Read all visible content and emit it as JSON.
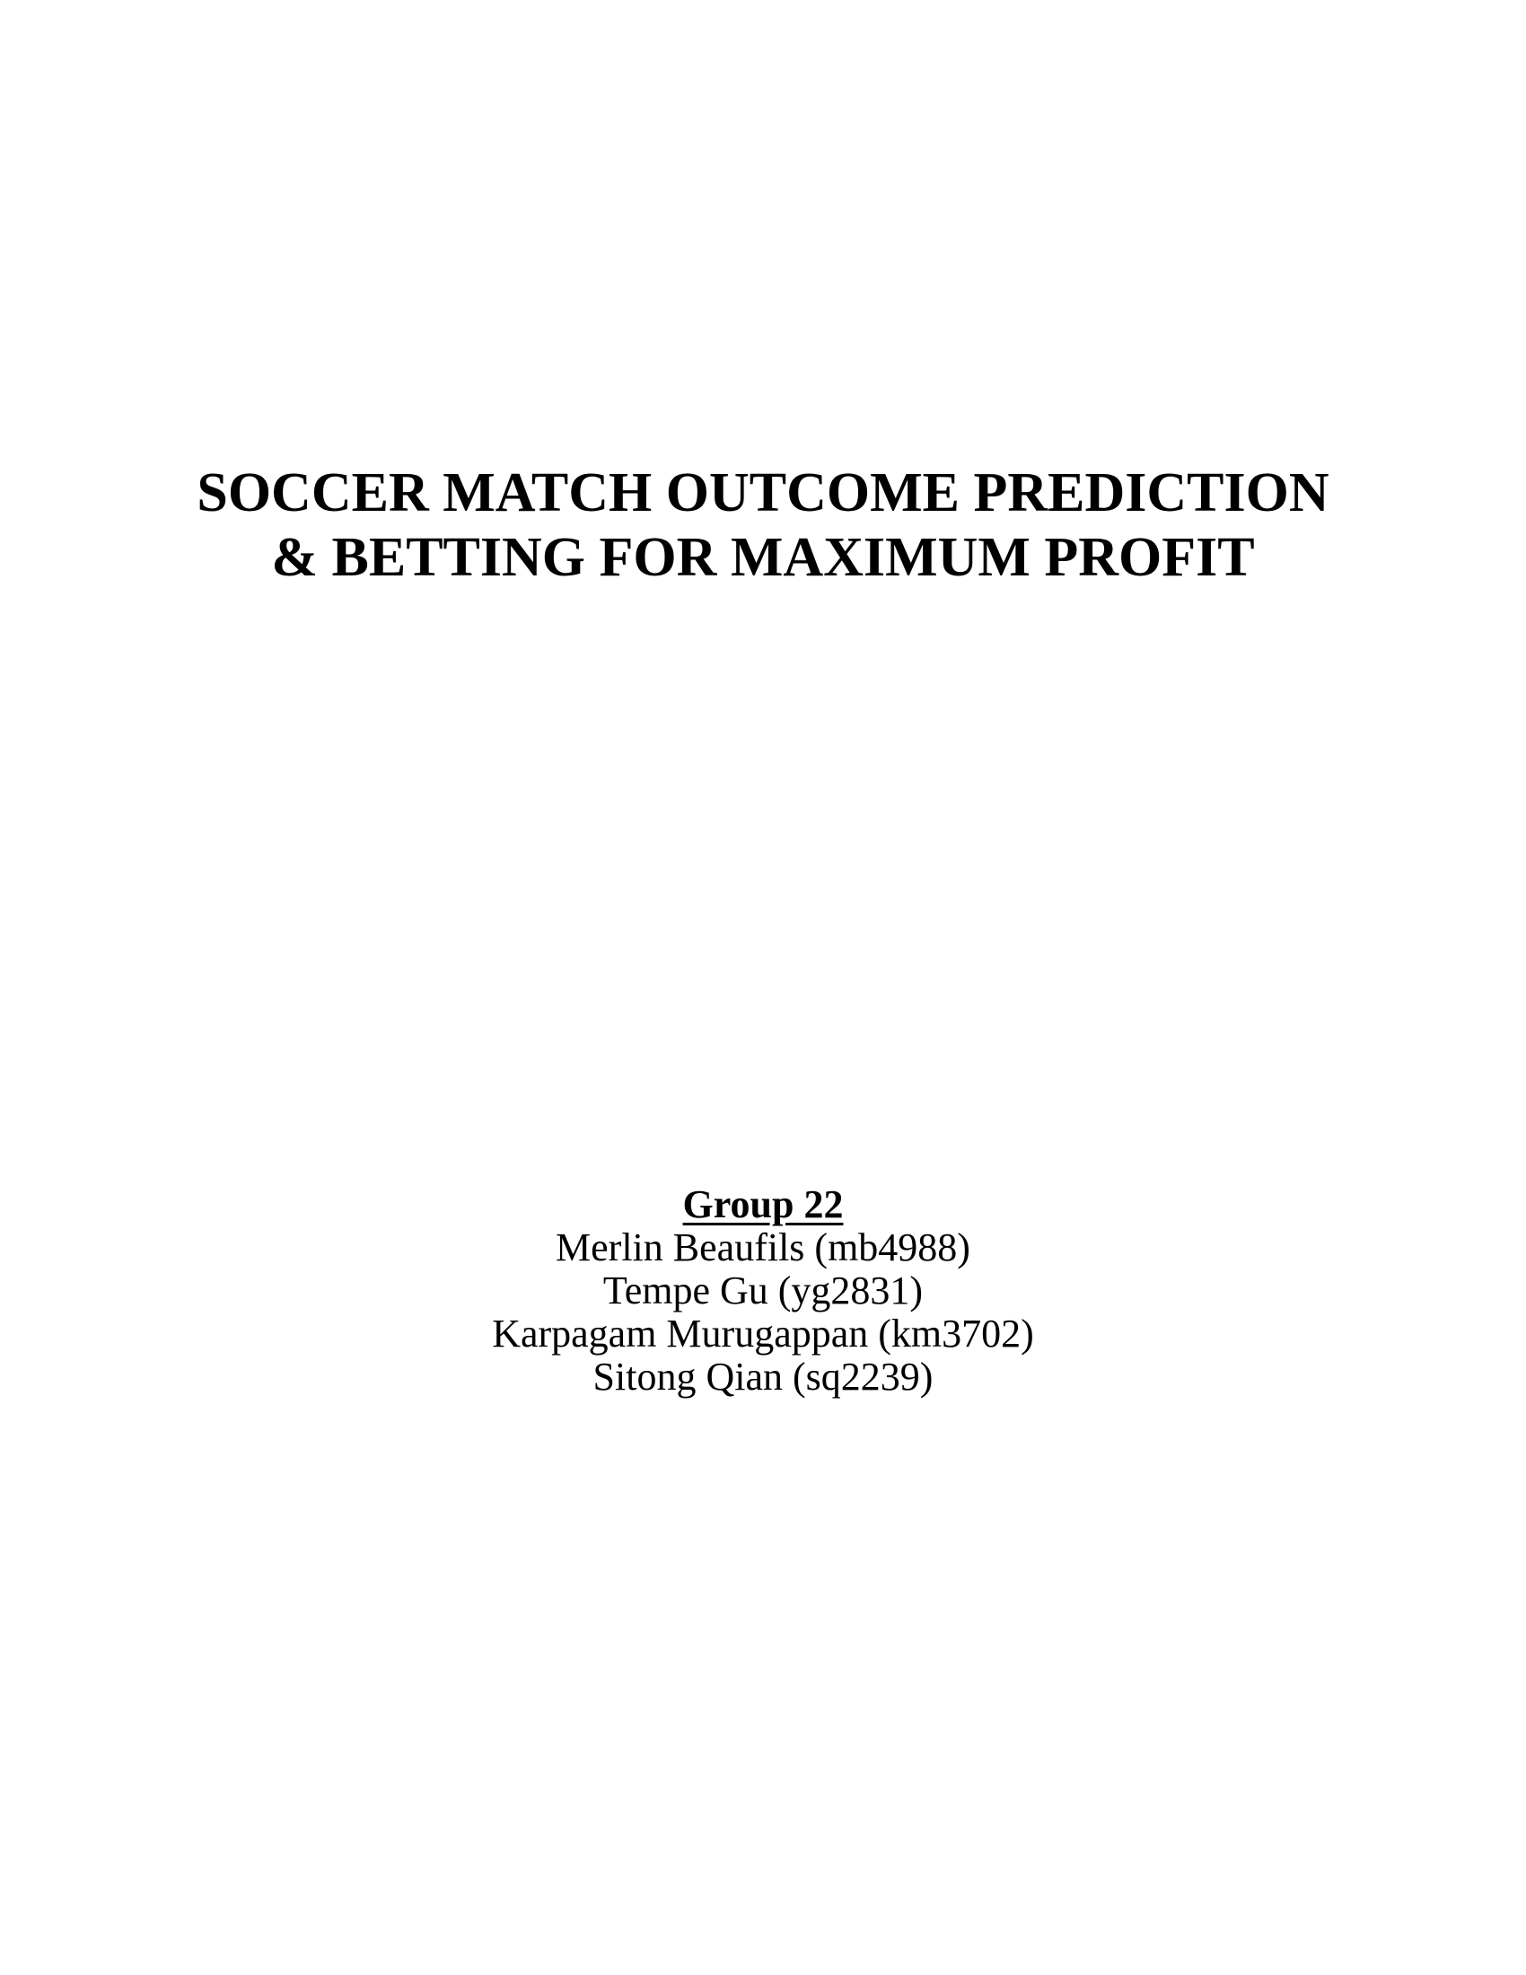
{
  "document": {
    "title_lines": [
      "SOCCER MATCH OUTCOME PREDICTION",
      "& BETTING FOR MAXIMUM PROFIT"
    ],
    "group": {
      "heading": "Group 22",
      "members": [
        "Merlin Beaufils (mb4988)",
        "Tempe Gu (yg2831)",
        "Karpagam Murugappan (km3702)",
        "Sitong Qian (sq2239)"
      ]
    }
  }
}
